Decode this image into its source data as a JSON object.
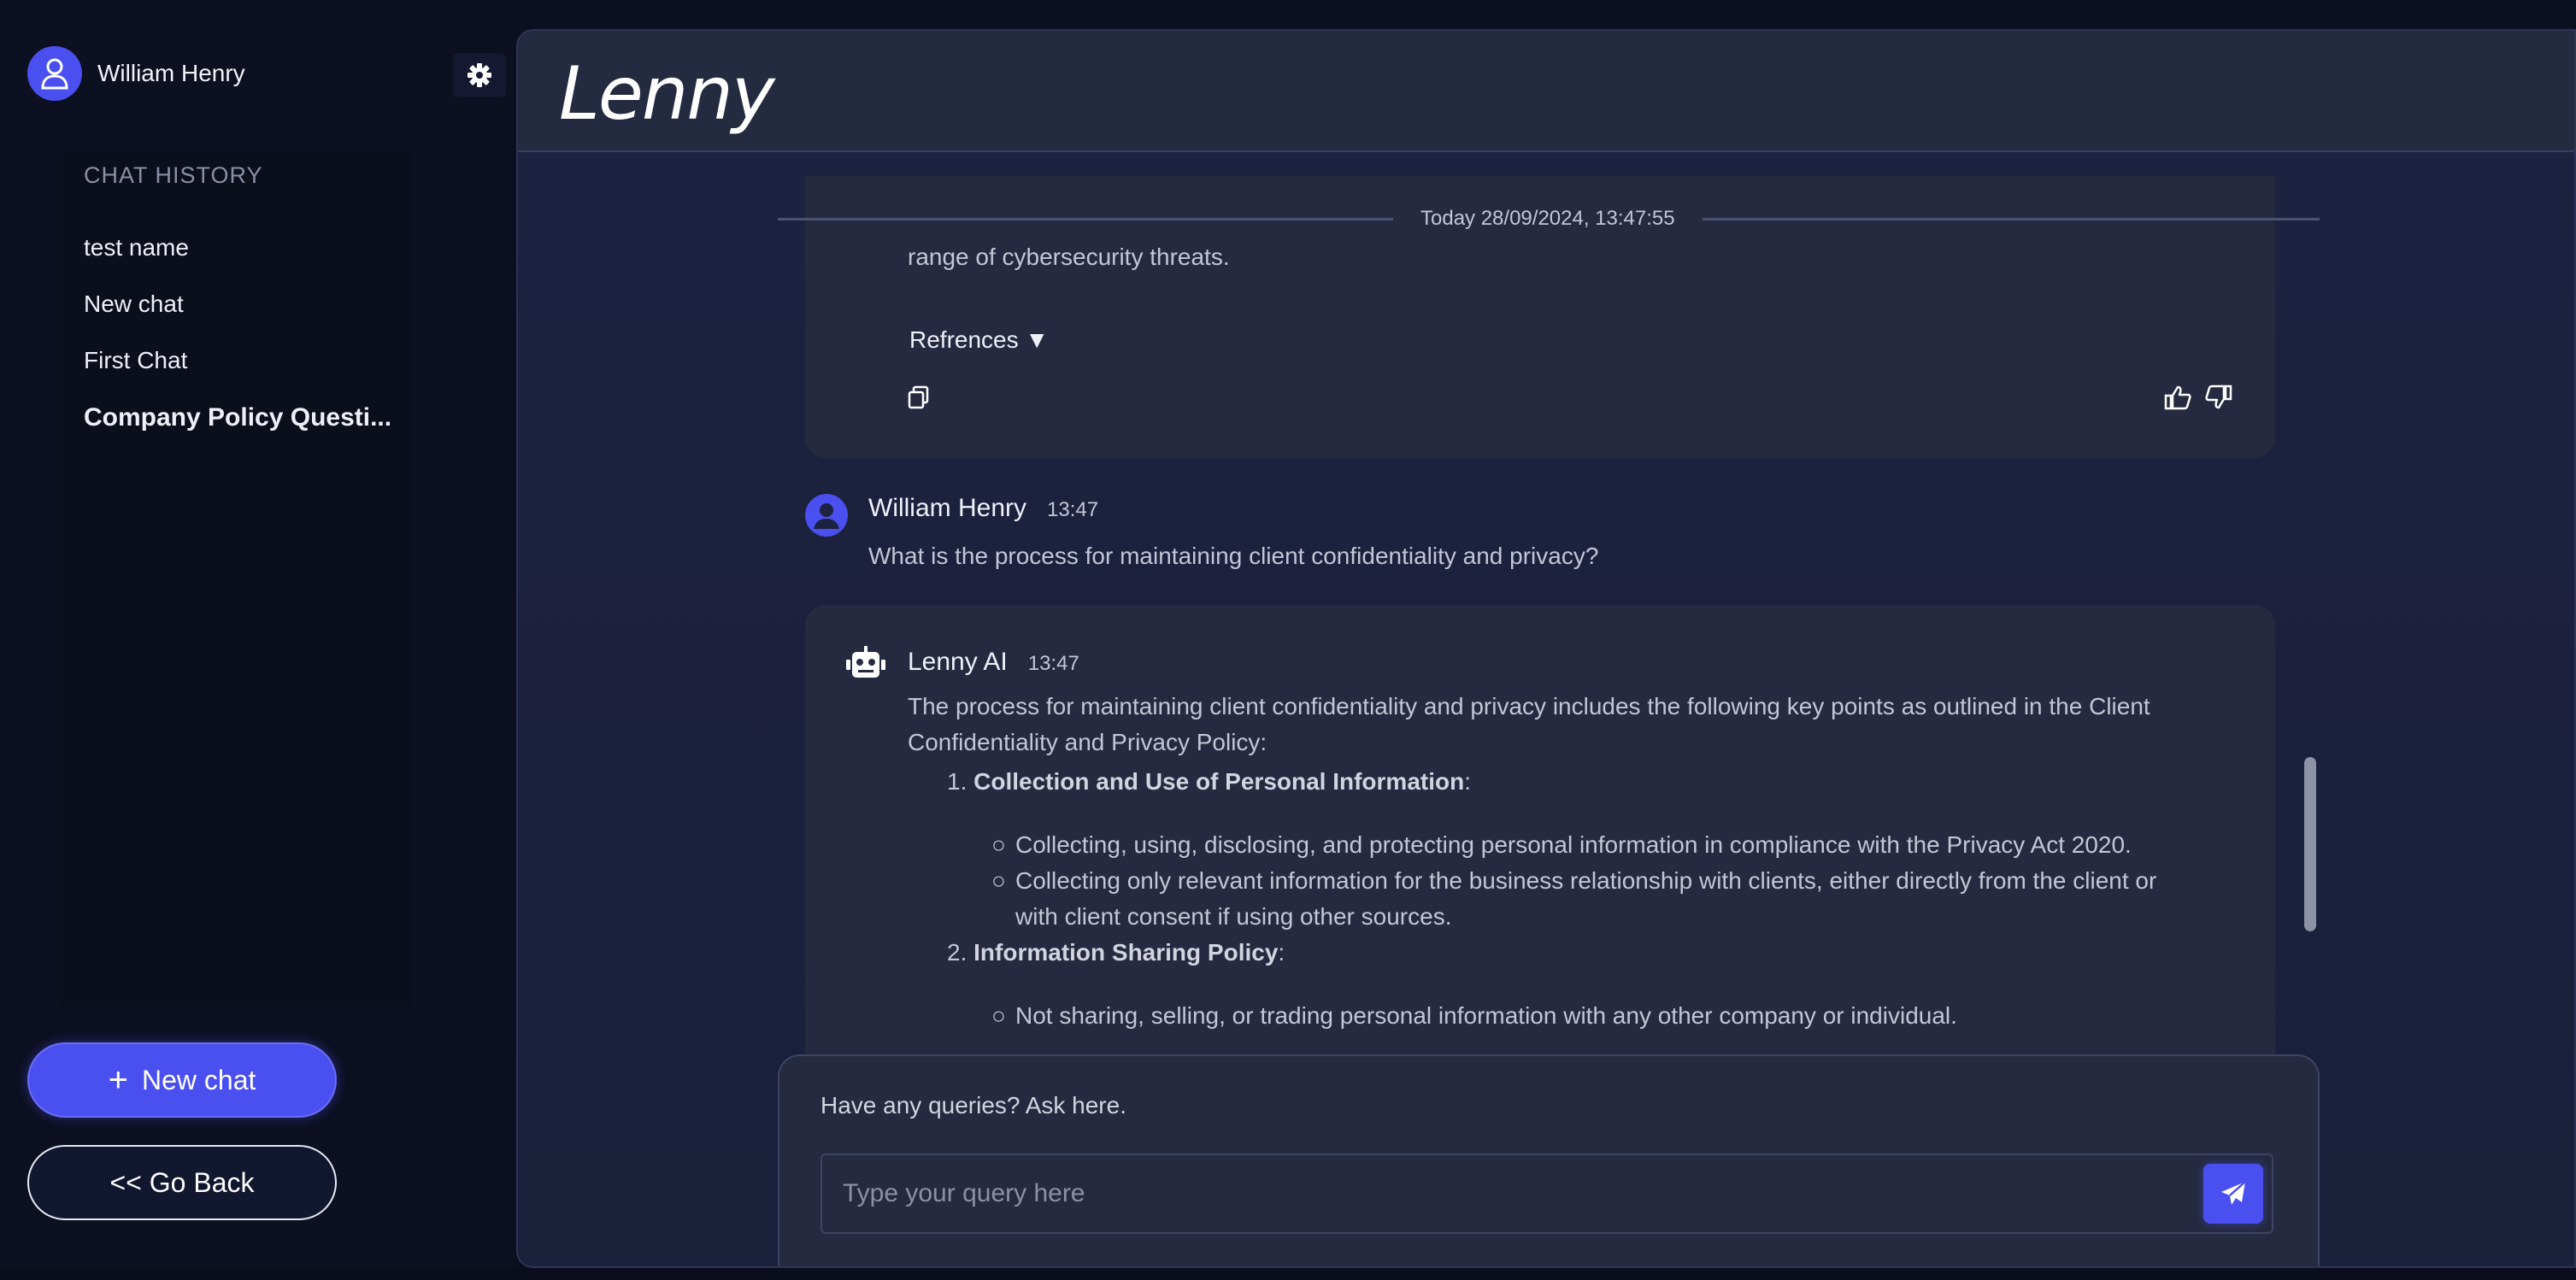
{
  "sidebar": {
    "user_name": "William Henry",
    "history_title": "CHAT HISTORY",
    "items": [
      {
        "label": "test name",
        "active": false
      },
      {
        "label": "New chat",
        "active": false
      },
      {
        "label": "First Chat",
        "active": false
      },
      {
        "label": "Company Policy Questi...",
        "active": true
      }
    ],
    "new_chat_label": "New chat",
    "go_back_label": "<< Go Back"
  },
  "header": {
    "logo": "Lenny"
  },
  "chat": {
    "date_separator": "Today 28/09/2024, 13:47:55",
    "prev_ai": {
      "tail_text": "range of cybersecurity threats.",
      "references_label": "Refrences ▼"
    },
    "user_msg": {
      "sender": "William Henry",
      "time": "13:47",
      "text": "What is the process for maintaining client confidentiality and privacy?"
    },
    "ai_msg": {
      "sender": "Lenny AI",
      "time": "13:47",
      "intro": "The process for maintaining client confidentiality and privacy includes the following key points as outlined in the Client Confidentiality and Privacy Policy:",
      "sections": [
        {
          "number": "1.",
          "title": "Collection and Use of Personal Information",
          "bullets": [
            "Collecting, using, disclosing, and protecting personal information in compliance with the Privacy Act 2020.",
            "Collecting only relevant information for the business relationship with clients, either directly from the client or with client consent if using other sources."
          ]
        },
        {
          "number": "2.",
          "title": "Information Sharing Policy",
          "bullets": [
            "Not sharing, selling, or trading personal information with any other company or individual."
          ]
        }
      ]
    }
  },
  "composer": {
    "label": "Have any queries? Ask here.",
    "placeholder": "Type your query here"
  },
  "colors": {
    "accent": "#4a4ff0",
    "panel": "#252a40",
    "background": "#0d1020"
  },
  "icons": [
    "user-icon",
    "gear-icon",
    "plus-icon",
    "copy-icon",
    "thumbs-up-icon",
    "thumbs-down-icon",
    "robot-icon",
    "send-icon"
  ]
}
